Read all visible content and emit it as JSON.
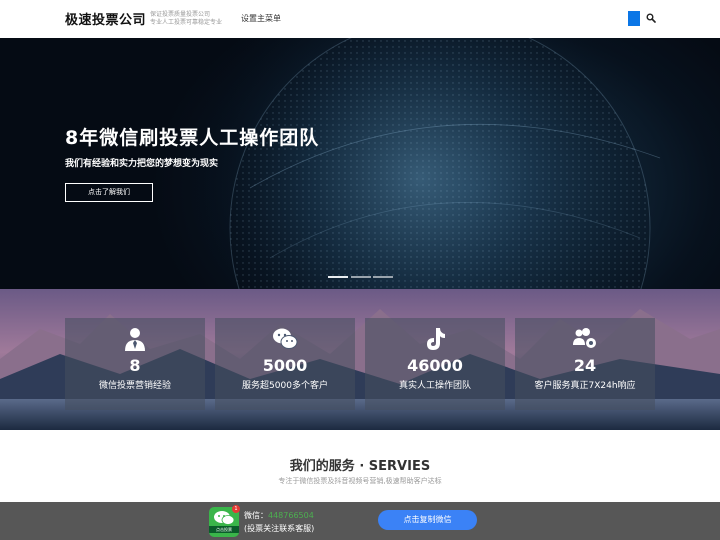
{
  "header": {
    "logo": "极速投票公司",
    "tagline_1": "保证投票质量投票公司",
    "tagline_2": "专业人工投票可靠稳定专业",
    "menu_label": "设置主菜单"
  },
  "hero": {
    "title": "8年微信刷投票人工操作团队",
    "subtitle": "我们有经验和实力把您的梦想变为现实",
    "button_label": "点击了解我们",
    "slide_count": 3,
    "active_slide": 1
  },
  "stats": [
    {
      "icon": "user-tie-icon",
      "number": "8",
      "label": "微信投票营销经验"
    },
    {
      "icon": "wechat-icon",
      "number": "5000",
      "label": "服务超5000多个客户"
    },
    {
      "icon": "tiktok-icon",
      "number": "46000",
      "label": "真实人工操作团队"
    },
    {
      "icon": "users-gear-icon",
      "number": "24",
      "label": "客户服务真正7X24h响应"
    }
  ],
  "services": {
    "title": "我们的服务 · SERVIES",
    "subtitle": "专注于微信投票及抖音视频号营销,极速帮助客户达标"
  },
  "footer": {
    "app_label": "点击投票",
    "badge": "1",
    "wechat_prefix": "微信：",
    "wechat_id": "448766504",
    "note": "(投票关注联系客服)",
    "copy_button": "点击复制微信"
  },
  "colors": {
    "accent_blue": "#0b76e6",
    "copy_button": "#3b82f6",
    "wechat_green": "#3ab54a",
    "footer_bg": "#575757"
  }
}
